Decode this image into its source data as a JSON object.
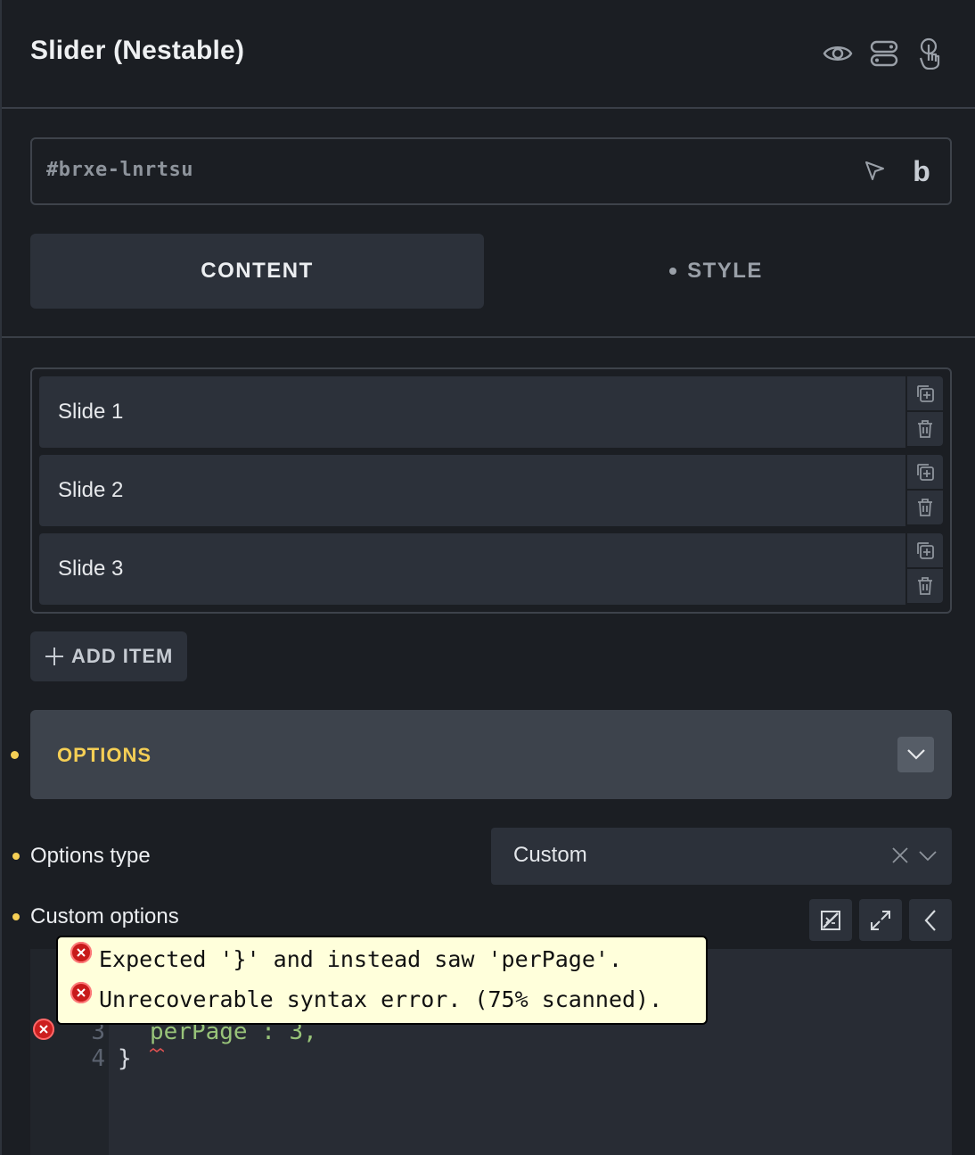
{
  "panel": {
    "title": "Slider (Nestable)",
    "element_id": "#brxe-lnrtsu",
    "header_icons": [
      "eye-icon",
      "toggle-icon",
      "hand-pointer-icon"
    ]
  },
  "tabs": {
    "content": "CONTENT",
    "style": "STYLE"
  },
  "items": [
    {
      "label": "Slide 1"
    },
    {
      "label": "Slide 2"
    },
    {
      "label": "Slide 3"
    }
  ],
  "add_item_label": "ADD ITEM",
  "options": {
    "title": "OPTIONS",
    "type_label": "Options type",
    "type_value": "Custom",
    "custom_label": "Custom options"
  },
  "editor": {
    "lines": [
      {
        "num": "3",
        "text": "perPage : 3,"
      },
      {
        "num": "4",
        "text": "}"
      }
    ]
  },
  "tooltip": {
    "errors": [
      "Expected '}' and instead saw 'perPage'.",
      "Unrecoverable syntax error. (75% scanned)."
    ]
  },
  "colors": {
    "background": "#1b1e23",
    "accent": "#f5cf55",
    "panel": "#2c313a",
    "error": "#c81a1a",
    "tooltip_bg": "#ffffdb"
  }
}
